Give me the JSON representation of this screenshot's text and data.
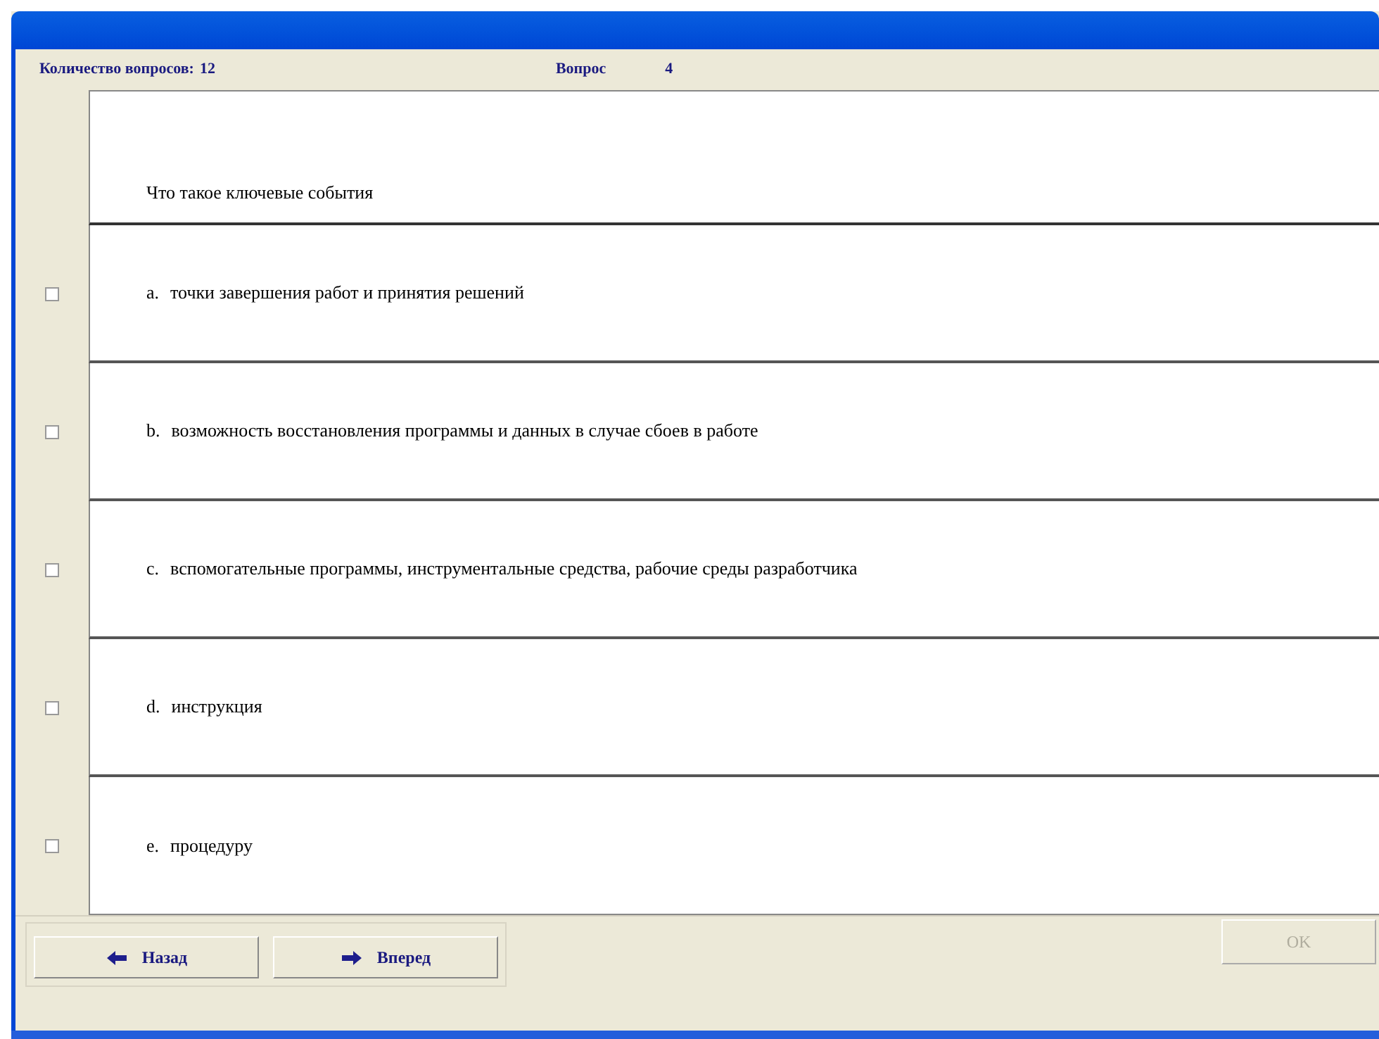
{
  "header": {
    "count_label": "Количество вопросов:",
    "count_value": "12",
    "question_label": "Вопрос",
    "question_value": "4"
  },
  "question": "Что такое ключевые события",
  "options": [
    {
      "letter": "a.",
      "text": "точки завершения работ и принятия решений",
      "checked": false
    },
    {
      "letter": "b.",
      "text": "возможность восстановления программы и данных в случае сбоев в работе",
      "checked": false
    },
    {
      "letter": "c.",
      "text": "вспомогательные программы, инструментальные средства, рабочие среды разработчика",
      "checked": false
    },
    {
      "letter": "d.",
      "text": "инструкция",
      "checked": false
    },
    {
      "letter": "e.",
      "text": "процедуру",
      "checked": false
    }
  ],
  "nav_buttons": [
    {
      "label": "Назад",
      "kind": "back"
    },
    {
      "label": "Вперед",
      "kind": "forward"
    }
  ],
  "ok_button": {
    "label": "OK",
    "disabled": true
  }
}
